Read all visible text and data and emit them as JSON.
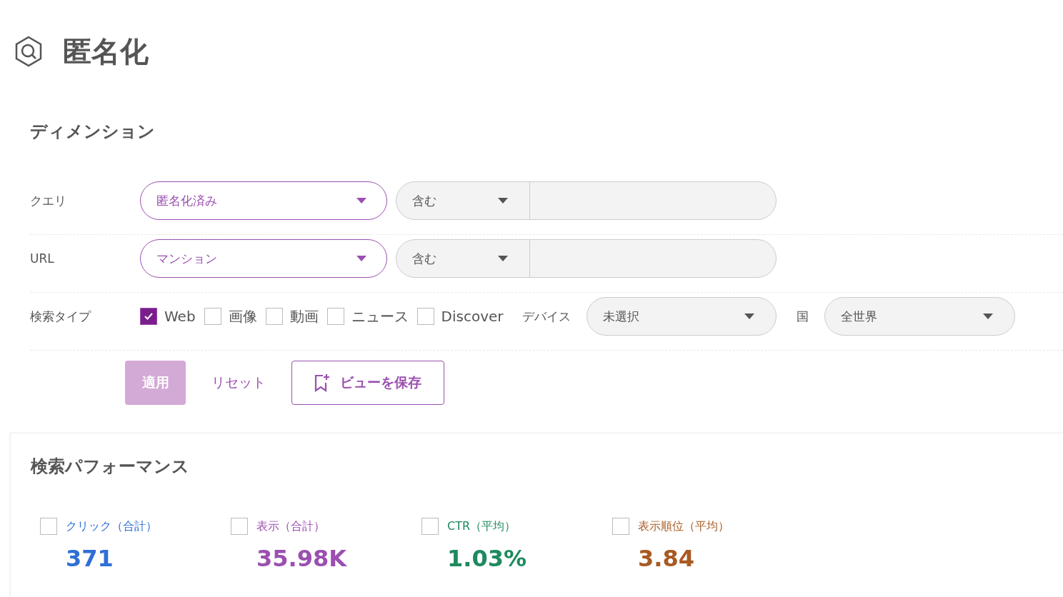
{
  "page": {
    "title": "匿名化"
  },
  "dimensions": {
    "title": "ディメンション",
    "filters": [
      {
        "label": "クエリ",
        "value": "匿名化済み",
        "match": "含む"
      },
      {
        "label": "URL",
        "value": "マンション",
        "match": "含む"
      }
    ],
    "search_type": {
      "label": "検索タイプ",
      "options": [
        {
          "label": "Web",
          "checked": true
        },
        {
          "label": "画像",
          "checked": false
        },
        {
          "label": "動画",
          "checked": false
        },
        {
          "label": "ニュース",
          "checked": false
        },
        {
          "label": "Discover",
          "checked": false
        }
      ]
    },
    "device": {
      "label": "デバイス",
      "value": "未選択"
    },
    "country": {
      "label": "国",
      "value": "全世界"
    },
    "buttons": {
      "apply": "適用",
      "reset": "リセット",
      "save": "ビューを保存"
    }
  },
  "performance": {
    "title": "検索パフォーマンス",
    "metrics": [
      {
        "label": "クリック（合計）",
        "value": "371",
        "color": "#2f6fd6",
        "checked": false
      },
      {
        "label": "表示（合計）",
        "value": "35.98K",
        "color": "#9b4fb0",
        "checked": false
      },
      {
        "label": "CTR（平均）",
        "value": "1.03%",
        "color": "#1e8a5e",
        "checked": false
      },
      {
        "label": "表示順位（平均）",
        "value": "3.84",
        "color": "#a85a23",
        "checked": false
      }
    ]
  }
}
